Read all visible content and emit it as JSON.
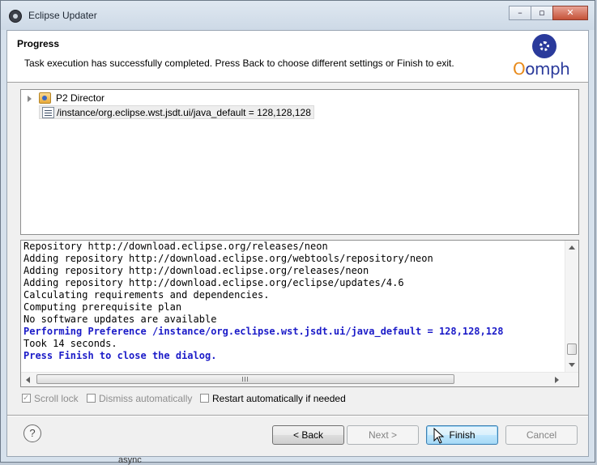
{
  "window": {
    "title": "Eclipse Updater",
    "controls": {
      "minimize": "–",
      "restore": "▫",
      "close": "✕"
    }
  },
  "header": {
    "title": "Progress",
    "message": "Task execution has successfully completed.  Press Back to choose different settings or Finish to exit.",
    "logo_text_first": "O",
    "logo_text_rest": "omph"
  },
  "tree": {
    "items": [
      {
        "label": "P2 Director",
        "icon": "p2-director-icon",
        "expandable": true
      },
      {
        "label": "/instance/org.eclipse.wst.jsdt.ui/java_default = 128,128,128",
        "icon": "preference-icon",
        "selected": true
      }
    ]
  },
  "log": {
    "lines": [
      {
        "text": "Repository http://download.eclipse.org/releases/neon",
        "highlight": false
      },
      {
        "text": "Adding repository http://download.eclipse.org/webtools/repository/neon",
        "highlight": false
      },
      {
        "text": "Adding repository http://download.eclipse.org/releases/neon",
        "highlight": false
      },
      {
        "text": "Adding repository http://download.eclipse.org/eclipse/updates/4.6",
        "highlight": false
      },
      {
        "text": "Calculating requirements and dependencies.",
        "highlight": false
      },
      {
        "text": "Computing prerequisite plan",
        "highlight": false
      },
      {
        "text": "No software updates are available",
        "highlight": false
      },
      {
        "text": "Performing Preference /instance/org.eclipse.wst.jsdt.ui/java_default = 128,128,128",
        "highlight": true
      },
      {
        "text": "Took 14 seconds.",
        "highlight": false
      },
      {
        "text": "Press Finish to close the dialog.",
        "highlight": true
      }
    ],
    "highlight_color": "#1b1bc8"
  },
  "options": {
    "scroll_lock": {
      "label": "Scroll lock",
      "checked": true,
      "enabled": false
    },
    "dismiss_auto": {
      "label": "Dismiss automatically",
      "checked": false,
      "enabled": false
    },
    "restart_auto": {
      "label": "Restart automatically if needed",
      "checked": false,
      "enabled": true
    }
  },
  "buttons": {
    "help": "?",
    "back": "< Back",
    "next": "Next >",
    "finish": "Finish",
    "cancel": "Cancel"
  },
  "background_text": "async"
}
